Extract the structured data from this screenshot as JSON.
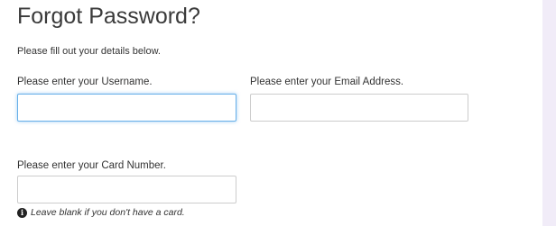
{
  "page": {
    "title": "Forgot Password?",
    "subtitle": "Please fill out your details below."
  },
  "form": {
    "username": {
      "label": "Please enter your Username.",
      "value": "",
      "focused": true
    },
    "email": {
      "label": "Please enter your Email Address.",
      "value": ""
    },
    "card": {
      "label": "Please enter your Card Number.",
      "value": "",
      "hint": "Leave blank if you don't have a card.",
      "hint_icon": "info-icon"
    }
  },
  "colors": {
    "page_background": "#f1ecf8",
    "panel_background": "#ffffff",
    "focus_border": "#66afe9",
    "field_border": "#cccccc",
    "text": "#333333"
  }
}
